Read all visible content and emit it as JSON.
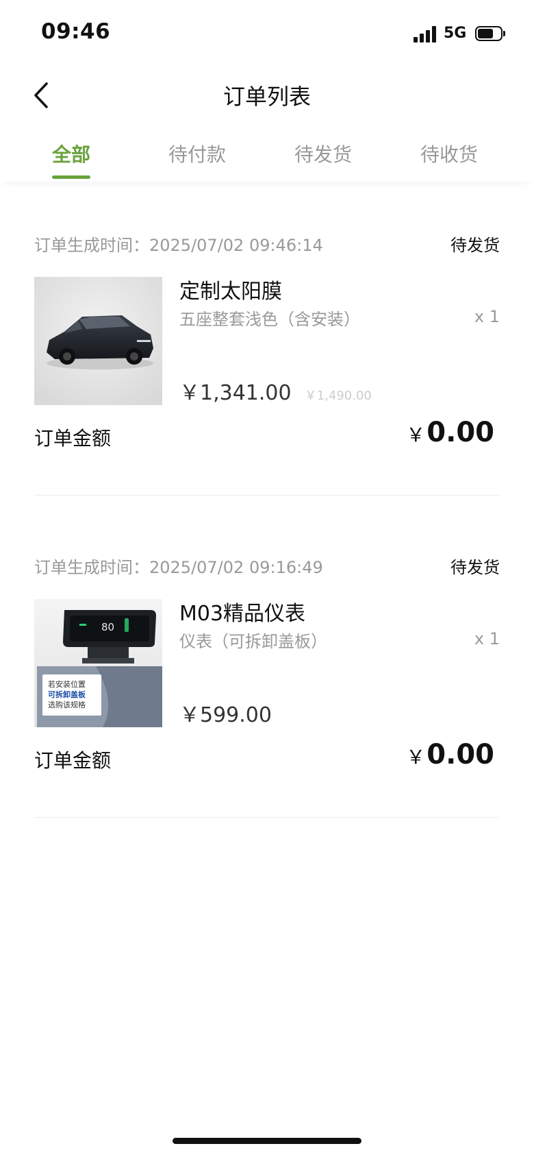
{
  "status_bar": {
    "time": "09:46",
    "network": "5G"
  },
  "header": {
    "title": "订单列表"
  },
  "tabs": [
    {
      "label": "全部",
      "active": true
    },
    {
      "label": "待付款",
      "active": false
    },
    {
      "label": "待发货",
      "active": false
    },
    {
      "label": "待收货",
      "active": false
    }
  ],
  "orders": [
    {
      "time": "订单生成时间：2025/07/02 09:46:14",
      "status": "待发货",
      "product": {
        "name": "定制太阳膜",
        "spec": "五座整套浅色（含安装）",
        "qty": "x 1",
        "price": "￥1,341.00",
        "original_price": "￥1,490.00"
      },
      "total_label": "订单金额",
      "total_currency": "￥",
      "total_value": "0.00"
    },
    {
      "time": "订单生成时间：2025/07/02 09:16:49",
      "status": "待发货",
      "product": {
        "name": "M03精品仪表",
        "spec": "仪表（可拆卸盖板）",
        "qty": "x 1",
        "price": "￥599.00",
        "image_text": {
          "speed": "80",
          "line1": "若安装位置",
          "line2": "可拆卸盖板",
          "line3": "选购该规格"
        }
      },
      "total_label": "订单金额",
      "total_currency": "￥",
      "total_value": "0.00"
    }
  ],
  "colors": {
    "accent": "#6aa23c",
    "muted": "#999999",
    "divider": "#ececec"
  }
}
